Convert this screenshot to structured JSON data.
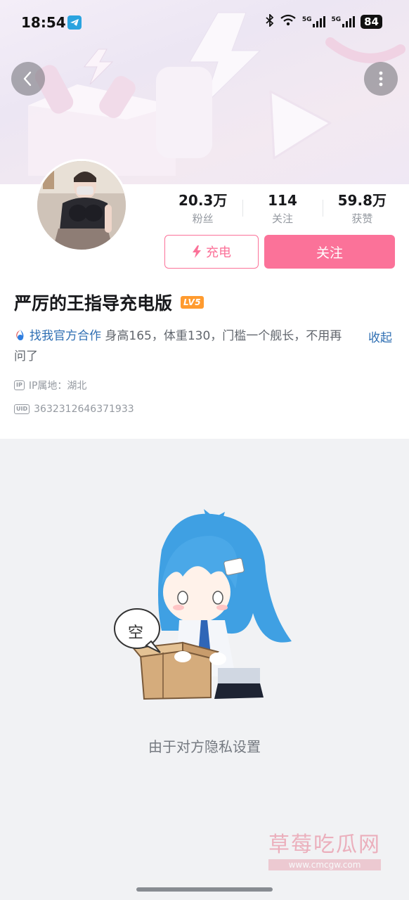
{
  "status_bar": {
    "time": "18:54",
    "network_1": "5G",
    "network_2": "5G",
    "battery": "84"
  },
  "profile": {
    "stats": [
      {
        "value": "20.3万",
        "label": "粉丝"
      },
      {
        "value": "114",
        "label": "关注"
      },
      {
        "value": "59.8万",
        "label": "获赞"
      }
    ],
    "charge_label": "充电",
    "follow_label": "关注",
    "name": "严厉的王指导充电版",
    "level_badge": "LV5",
    "bio_link": "找我官方合作",
    "bio_text": "身高165，体重130，门槛一个舰长，不用再问了",
    "collapse_label": "收起",
    "ip_tag": "IP",
    "ip_location": "IP属地：湖北",
    "uid_tag": "UID",
    "uid": "3632312646371933"
  },
  "empty_state": {
    "bubble_text": "空",
    "message": "由于对方隐私设置"
  },
  "watermark": {
    "title": "草莓吃瓜网",
    "url": "www.cmcgw.com"
  },
  "colors": {
    "accent_pink": "#fb7299",
    "link_blue": "#2f6fb3",
    "level_orange": "#ff9b2f"
  }
}
